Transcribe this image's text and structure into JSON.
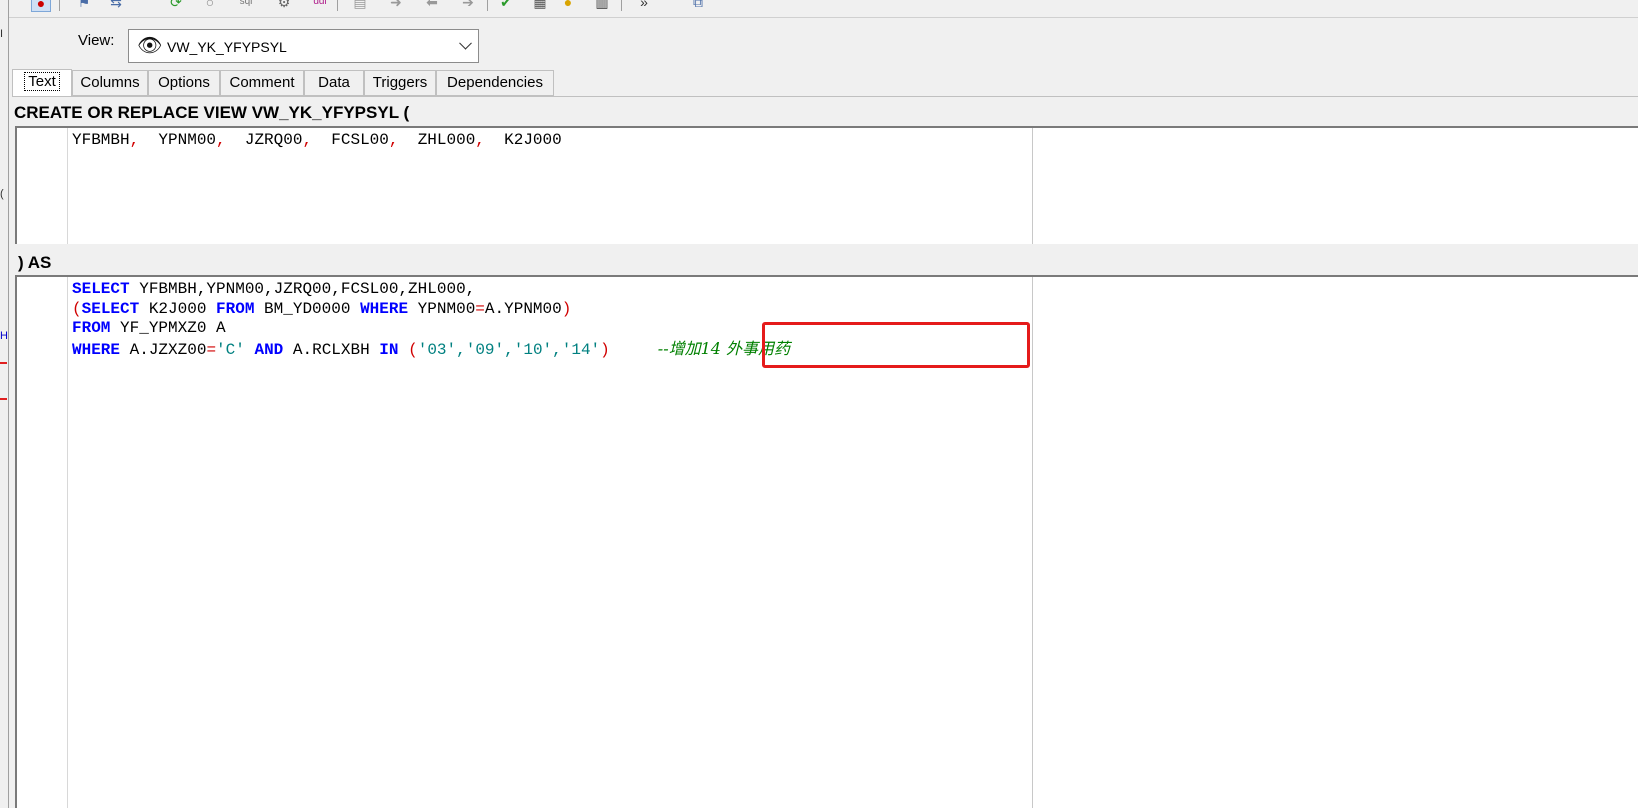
{
  "view": {
    "label": "View:",
    "selected": "VW_YK_YFYPSYL",
    "icon": "eye-icon"
  },
  "tabs": [
    {
      "label": "Text",
      "active": true
    },
    {
      "label": "Columns"
    },
    {
      "label": "Options"
    },
    {
      "label": "Comment"
    },
    {
      "label": "Data"
    },
    {
      "label": "Triggers"
    },
    {
      "label": "Dependencies"
    }
  ],
  "header_sql": "CREATE OR REPLACE VIEW VW_YK_YFYPSYL (",
  "columns_sql": {
    "items": [
      "YFBMBH",
      "YPNM00",
      "JZRQ00",
      "FCSL00",
      "ZHL000",
      "K2J000"
    ],
    "separator": ","
  },
  "as_label": ") AS",
  "body_sql": {
    "line1": {
      "kw": "SELECT",
      "rest": " YFBMBH,YPNM00,JZRQ00,FCSL00,ZHL000,"
    },
    "line2": {
      "open": "(",
      "kw1": "SELECT",
      "mid1": " K2J000 ",
      "kw2": "FROM",
      "mid2": " BM_YD0000 ",
      "kw3": "WHERE",
      "mid3": " YPNM00",
      "eq": "=",
      "mid4": "A.YPNM00",
      "close": ")"
    },
    "line3": {
      "kw": "FROM",
      "rest": " YF_YPMXZ0 A"
    },
    "line4": {
      "kw1": "WHERE",
      "mid1": " A.JZXZ00",
      "eq": "=",
      "str1": "'C'",
      "sp": " ",
      "kw2": "AND",
      "mid2": " A.RCLXBH ",
      "kw3": "IN",
      "sp2": " ",
      "open": "(",
      "vals": "'03','09','10','14'",
      "close": ")",
      "comment": "--增加14 外事用药"
    }
  },
  "colors": {
    "keyword": "#0000ff",
    "string": "#008080",
    "paren": "#d00000",
    "comment": "#008000",
    "highlight": "#e51b1b"
  }
}
